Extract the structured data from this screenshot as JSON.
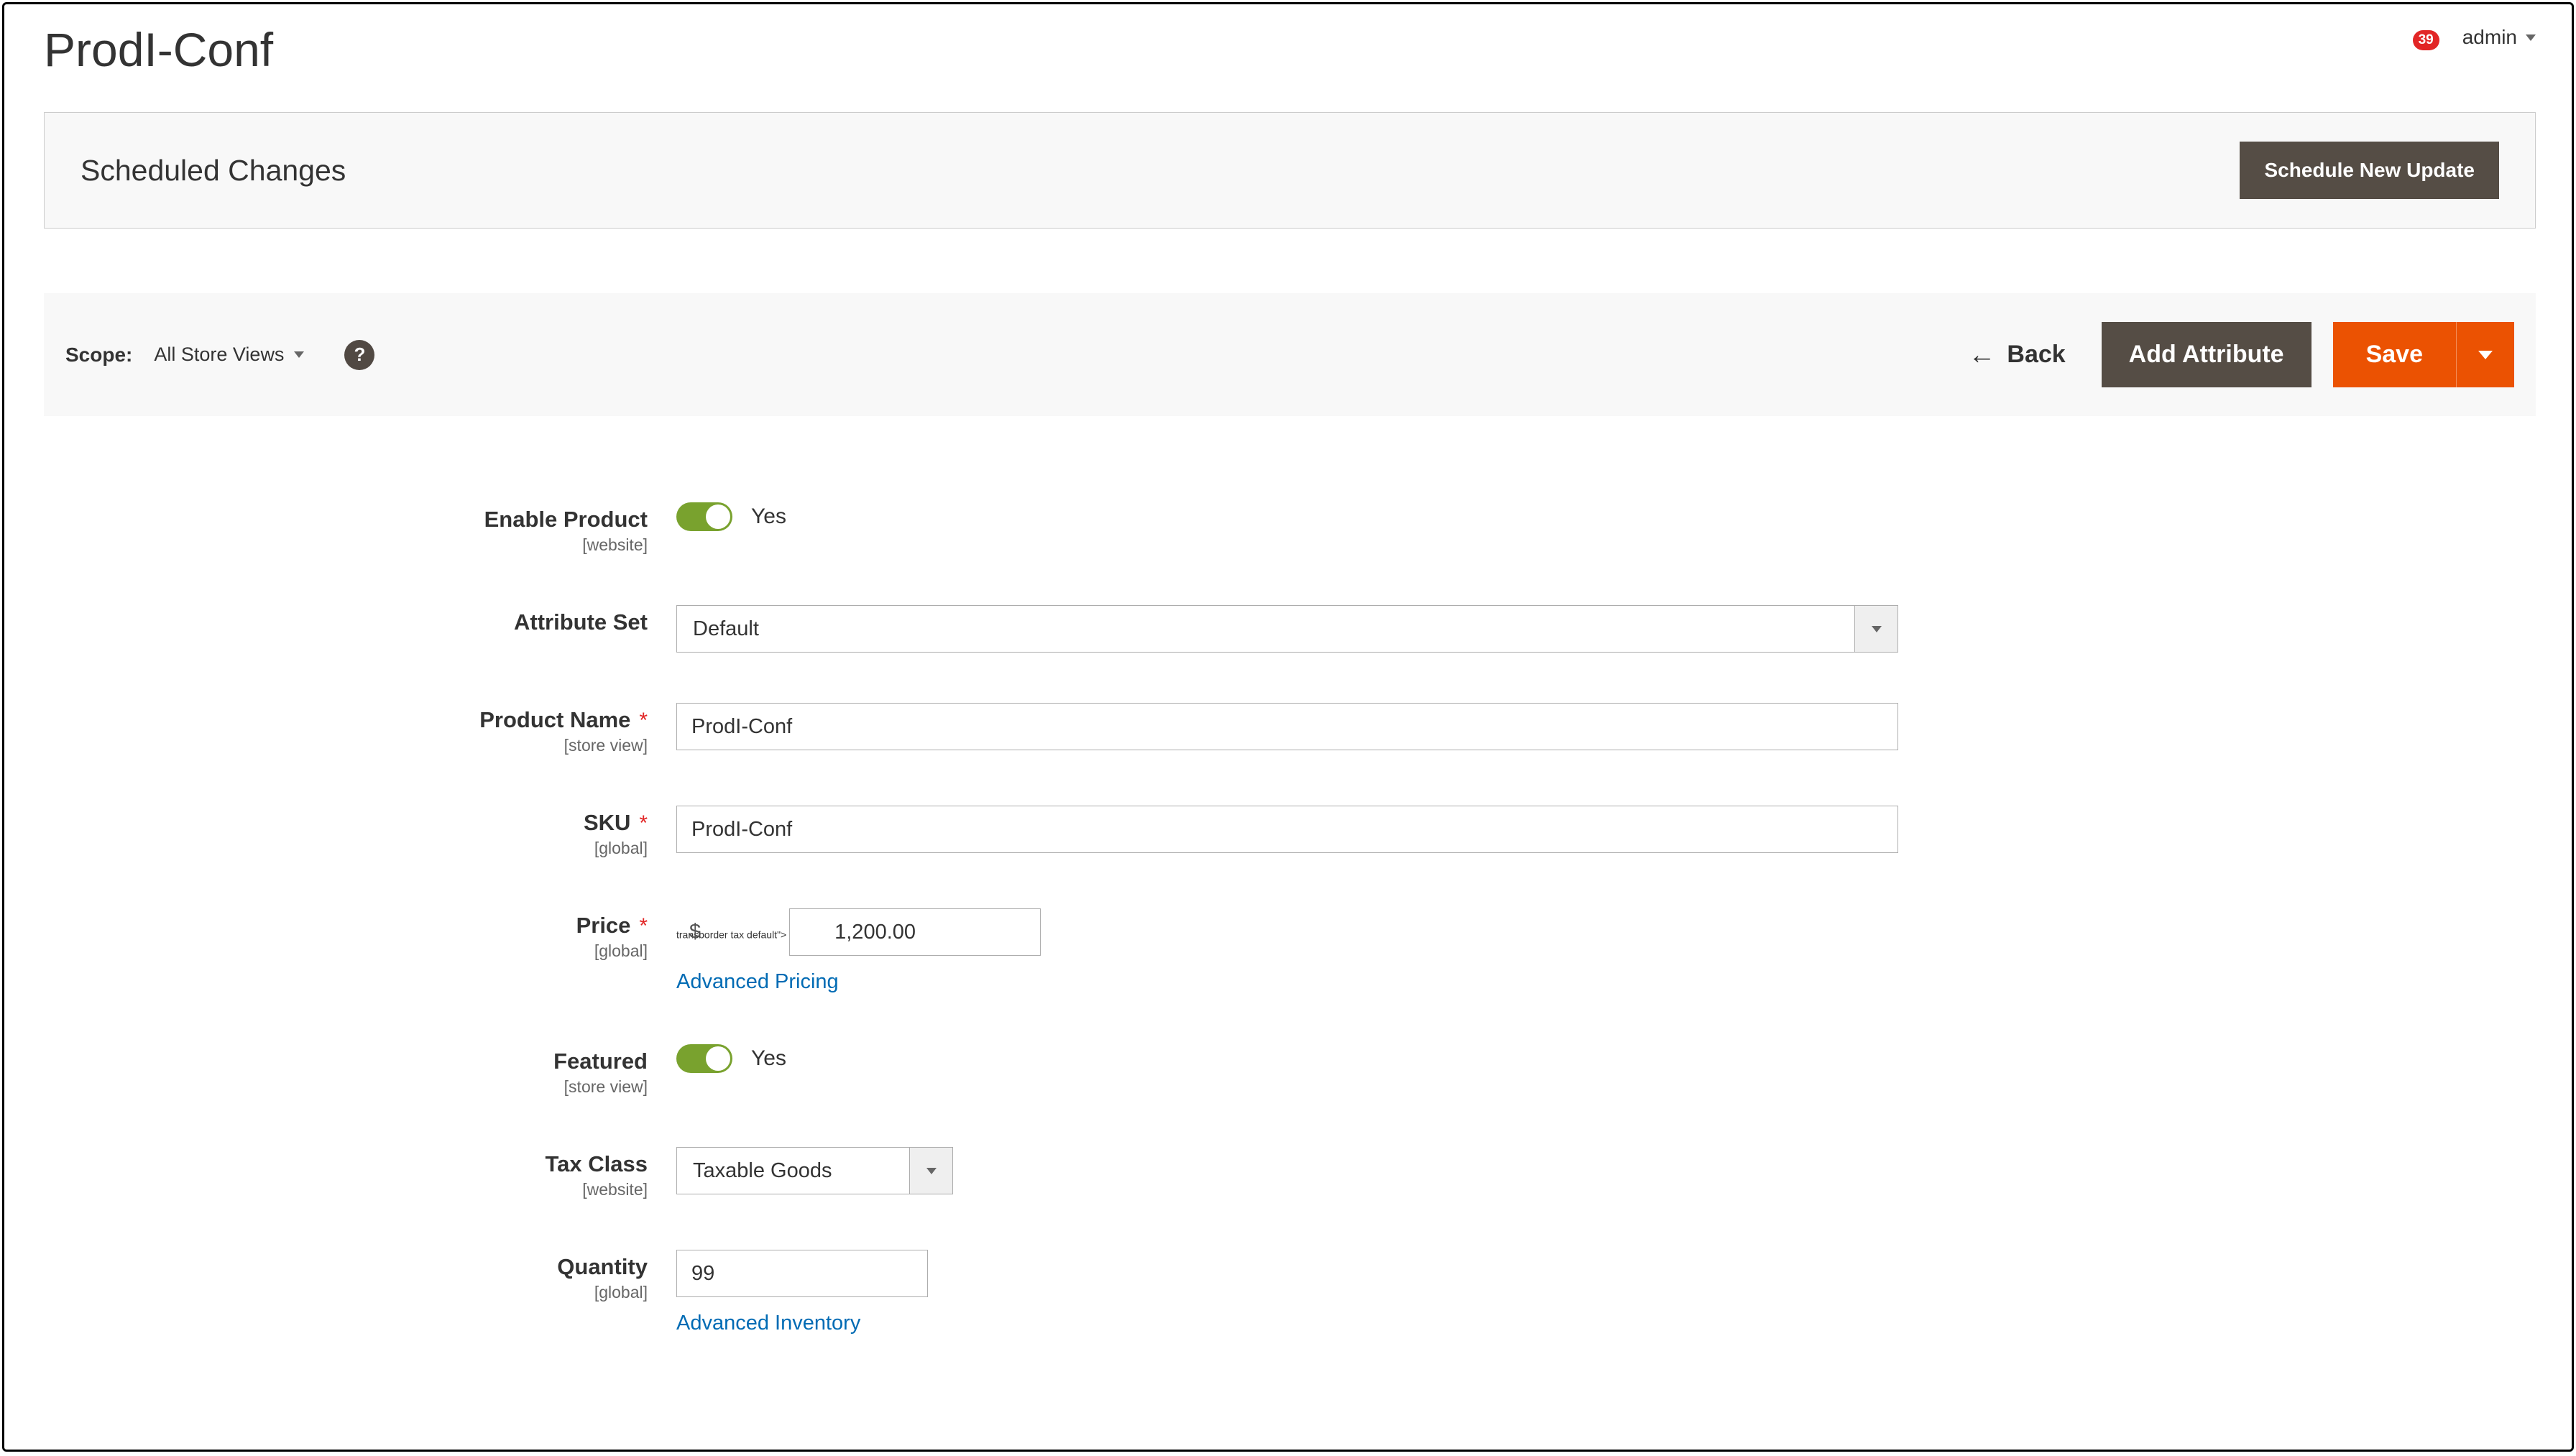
{
  "page": {
    "title": "ProdI-Conf"
  },
  "header": {
    "notification_count": "39",
    "user_name": "admin"
  },
  "scheduled": {
    "title": "Scheduled Changes",
    "button": "Schedule New Update"
  },
  "scopebar": {
    "label": "Scope:",
    "view": "All Store Views",
    "back": "Back",
    "add_attribute": "Add Attribute",
    "save": "Save"
  },
  "form": {
    "enable_product": {
      "label": "Enable Product",
      "scope": "[website]",
      "value_text": "Yes"
    },
    "attribute_set": {
      "label": "Attribute Set",
      "value": "Default"
    },
    "product_name": {
      "label": "Product Name",
      "scope": "[store view]",
      "value": "ProdI-Conf"
    },
    "sku": {
      "label": "SKU",
      "scope": "[global]",
      "value": "ProdI-Conf"
    },
    "price": {
      "label": "Price",
      "scope": "[global]",
      "currency": "$",
      "value": "1,200.00",
      "link": "Advanced Pricing"
    },
    "featured": {
      "label": "Featured",
      "scope": "[store view]",
      "value_text": "Yes"
    },
    "tax_class": {
      "label": "Tax Class",
      "scope": "[website]",
      "value": "Taxable Goods"
    },
    "quantity": {
      "label": "Quantity",
      "scope": "[global]",
      "value": "99",
      "link": "Advanced Inventory"
    }
  }
}
